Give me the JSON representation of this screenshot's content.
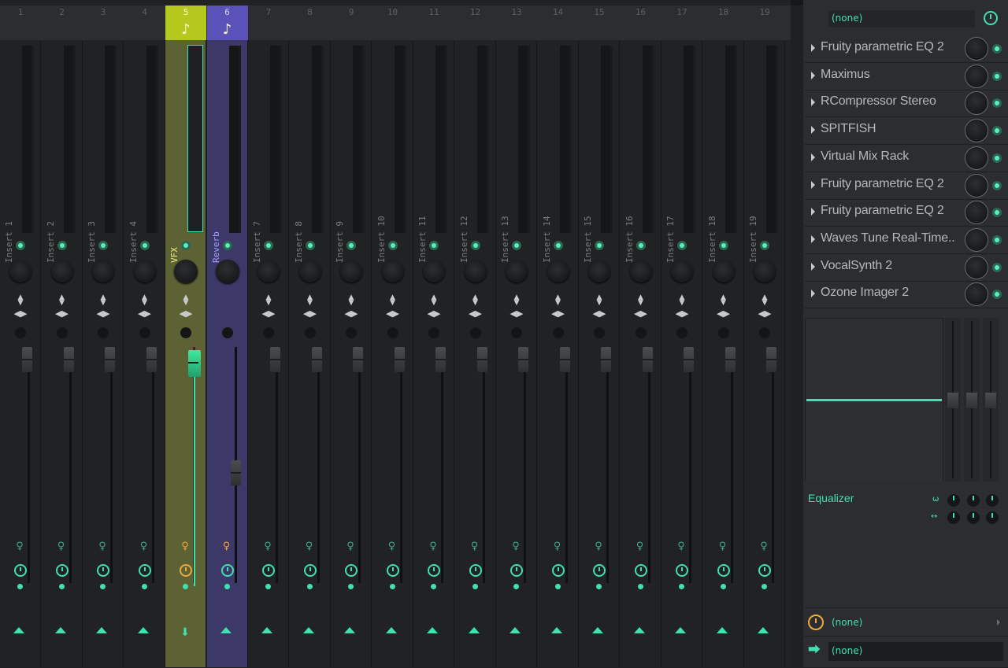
{
  "mixer": {
    "tracks": [
      {
        "number": "1",
        "name": "Insert 1"
      },
      {
        "number": "2",
        "name": "Insert 2"
      },
      {
        "number": "3",
        "name": "Insert 3"
      },
      {
        "number": "4",
        "name": "Insert 4"
      },
      {
        "number": "5",
        "name": "VFX",
        "note_icon": "♪"
      },
      {
        "number": "6",
        "name": "Reverb",
        "note_icon": "♪"
      },
      {
        "number": "7",
        "name": "Insert 7"
      },
      {
        "number": "8",
        "name": "Insert 8"
      },
      {
        "number": "9",
        "name": "Insert 9"
      },
      {
        "number": "10",
        "name": "Insert 10"
      },
      {
        "number": "11",
        "name": "Insert 11"
      },
      {
        "number": "12",
        "name": "Insert 12"
      },
      {
        "number": "13",
        "name": "Insert 13"
      },
      {
        "number": "14",
        "name": "Insert 14"
      },
      {
        "number": "15",
        "name": "Insert 15"
      },
      {
        "number": "16",
        "name": "Insert 16"
      },
      {
        "number": "17",
        "name": "Insert 17"
      },
      {
        "number": "18",
        "name": "Insert 18"
      },
      {
        "number": "19",
        "name": "Insert 19"
      }
    ],
    "selected_track": "5",
    "icons": {
      "led": "led-icon",
      "knob": "pan-knob",
      "stereo": "stereo-separation-icon",
      "bulb": "lightbulb-icon",
      "clock": "clock-icon",
      "route": "route-arrow-icon"
    }
  },
  "insert_panel": {
    "preset": "(none)",
    "slots": [
      {
        "name": "Fruity parametric EQ 2"
      },
      {
        "name": "Maximus"
      },
      {
        "name": "RCompressor Stereo"
      },
      {
        "name": "SPITFISH"
      },
      {
        "name": "Virtual Mix Rack"
      },
      {
        "name": "Fruity parametric EQ 2"
      },
      {
        "name": "Fruity parametric EQ 2"
      },
      {
        "name": "Waves Tune Real-Time.."
      },
      {
        "name": "VocalSynth 2"
      },
      {
        "name": "Ozone Imager 2"
      }
    ],
    "equalizer_label": "Equalizer",
    "input_label": "(none)",
    "output_label": "(none)"
  },
  "colors": {
    "accent": "#40e0b0",
    "selected_track": "#b4c81e",
    "reverb_track": "#5a52b8",
    "bulb_on": "#f4a23c"
  }
}
